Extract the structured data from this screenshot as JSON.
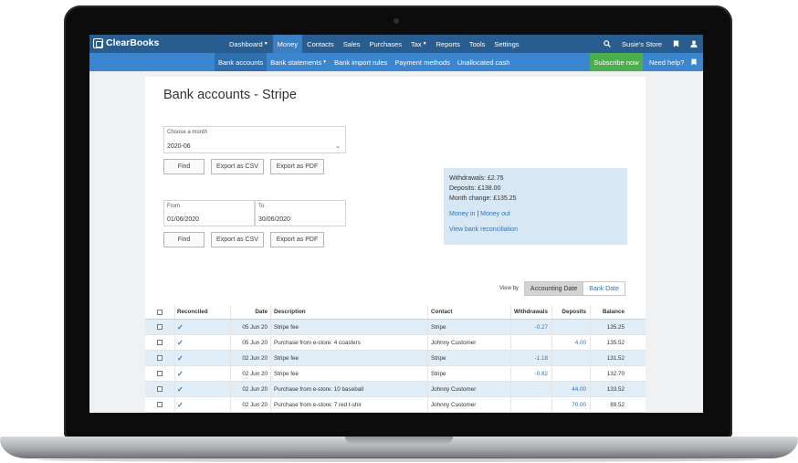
{
  "app": {
    "logo": "ClearBooks",
    "store": "Susie's Store"
  },
  "nav": [
    "Dashboard",
    "Money",
    "Contacts",
    "Sales",
    "Purchases",
    "Tax",
    "Reports",
    "Tools",
    "Settings"
  ],
  "subnav": [
    "Bank accounts",
    "Bank statements",
    "Bank import rules",
    "Payment methods",
    "Unallocated cash"
  ],
  "subscribe_label": "Subscribe now",
  "help_label": "Need help?",
  "page": {
    "title": "Bank accounts - Stripe",
    "month": {
      "label": "Choose a month",
      "value": "2020-06"
    },
    "range": {
      "from_label": "From",
      "from_value": "01/06/2020",
      "to_label": "To",
      "to_value": "30/06/2020"
    },
    "buttons": {
      "find": "Find",
      "csv": "Export as CSV",
      "pdf": "Export as PDF"
    }
  },
  "summary": {
    "withdrawals": "Withdrawals: £2.75",
    "deposits": "Deposits: £138.00",
    "month_change": "Month change: £135.25",
    "money_in": "Money in",
    "separator": "|",
    "money_out": "Money out",
    "reconciliation": "View bank reconciliation"
  },
  "viewby": {
    "label": "View by",
    "accounting": "Accounting Date",
    "bank": "Bank Date"
  },
  "table": {
    "headers": {
      "reconciled": "Reconciled",
      "date": "Date",
      "description": "Description",
      "contact": "Contact",
      "withdrawals": "Withdrawals",
      "deposits": "Deposits",
      "balance": "Balance"
    },
    "rows": [
      {
        "date": "05 Jun 20",
        "description": "Stripe fee",
        "contact": "Stripe",
        "withdrawal": "-0.27",
        "deposit": "",
        "balance": "135.25"
      },
      {
        "date": "05 Jun 20",
        "description": "Purchase from e-store: 4 coasters",
        "contact": "Johnny Customer",
        "withdrawal": "",
        "deposit": "4.00",
        "balance": "135.52"
      },
      {
        "date": "02 Jun 20",
        "description": "Stripe fee",
        "contact": "Stripe",
        "withdrawal": "-1.18",
        "deposit": "",
        "balance": "131.52"
      },
      {
        "date": "02 Jun 20",
        "description": "Stripe fee",
        "contact": "Stripe",
        "withdrawal": "-0.82",
        "deposit": "",
        "balance": "132.70"
      },
      {
        "date": "02 Jun 20",
        "description": "Purchase from e-store: 10 baseball",
        "contact": "Johnny Customer",
        "withdrawal": "",
        "deposit": "44.00",
        "balance": "133.52"
      },
      {
        "date": "02 Jun 20",
        "description": "Purchase from e-store: 7 red t-shir",
        "contact": "Johnny Customer",
        "withdrawal": "",
        "deposit": "70.00",
        "balance": "89.52"
      }
    ]
  }
}
